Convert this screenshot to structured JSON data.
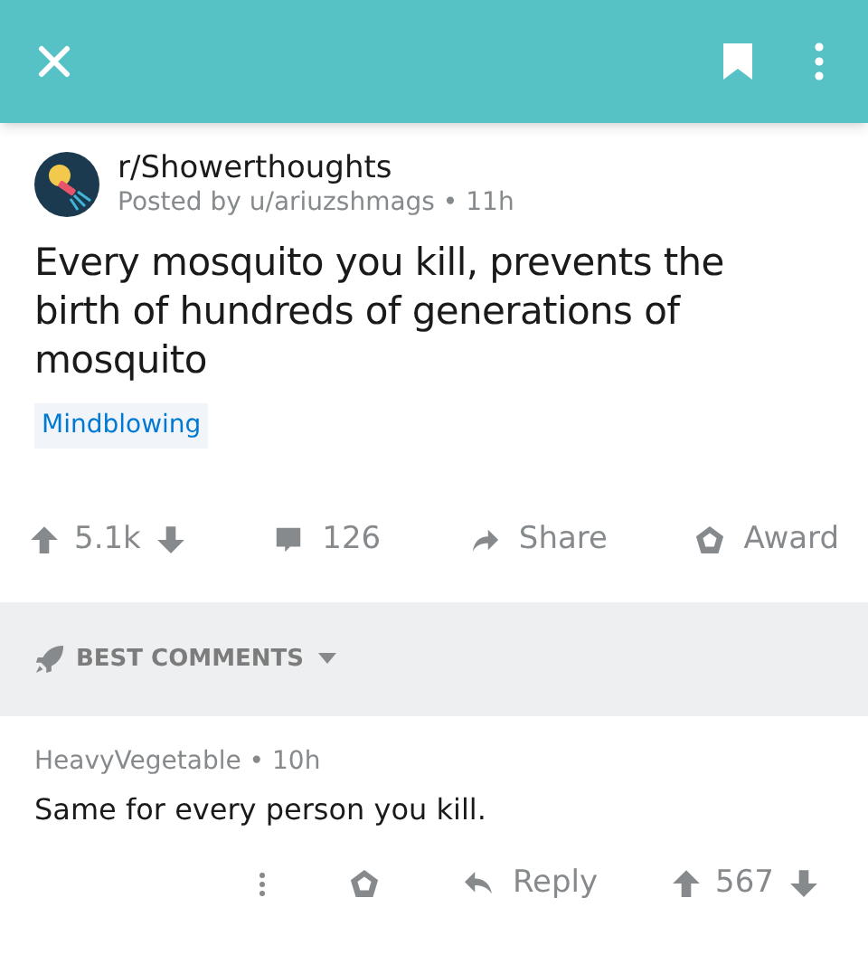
{
  "post": {
    "subreddit": "r/Showerthoughts",
    "byline": "Posted by u/ariuzshmags • 11h",
    "title": "Every mosquito you kill, prevents the birth of hundreds of generations of mosquito",
    "flair": "Mindblowing",
    "score": "5.1k",
    "comments": "126",
    "share": "Share",
    "award": "Award"
  },
  "sort": {
    "label": "BEST COMMENTS"
  },
  "comments": [
    {
      "byline": "HeavyVegetable • 10h",
      "body": "Same for every person you kill.",
      "reply": "Reply",
      "score": "567"
    }
  ]
}
